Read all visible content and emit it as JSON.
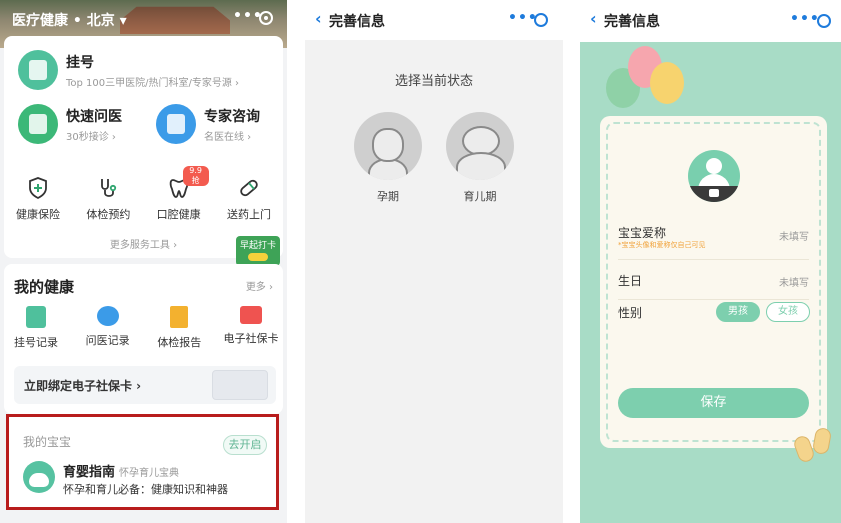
{
  "panel1": {
    "header": {
      "title": "医疗健康 • 北京 ▾",
      "more": "•••"
    },
    "main_services": [
      {
        "title": "挂号",
        "sub": "Top 100三甲医院/热门科室/专家号源 ›",
        "color": "#4fc09c"
      },
      {
        "title": "快速问医",
        "sub": "30秒接诊 ›",
        "color": "#3cb878"
      },
      {
        "title": "专家咨询",
        "sub": "名医在线 ›",
        "color": "#3b9be8"
      }
    ],
    "tools": [
      {
        "label": "健康保险",
        "icon": "shield-plus-icon"
      },
      {
        "label": "体检预约",
        "icon": "stethoscope-icon"
      },
      {
        "label": "口腔健康",
        "icon": "tooth-icon",
        "badge": "9.9抢"
      },
      {
        "label": "送药上门",
        "icon": "pill-icon"
      }
    ],
    "more_tools": "更多服务工具 ›",
    "promo": {
      "label": "早起打卡"
    },
    "my_health": {
      "title": "我的健康",
      "more": "更多 ›",
      "items": [
        {
          "label": "挂号记录",
          "icon": "register-record-icon",
          "color": "#4fc09c"
        },
        {
          "label": "问医记录",
          "icon": "chat-record-icon",
          "color": "#3b9be8"
        },
        {
          "label": "体检报告",
          "icon": "report-icon",
          "color": "#f3b12f"
        },
        {
          "label": "电子社保卡",
          "icon": "social-card-icon",
          "color": "#ef5350"
        }
      ],
      "bind_card": "立即绑定电子社保卡 ›"
    },
    "baby": {
      "title": "我的宝宝",
      "open_button": "去开启",
      "guide_title": "育婴指南",
      "guide_tag": "怀孕育儿宝典",
      "guide_desc": "怀孕和育儿必备：健康知识和神器"
    }
  },
  "panel2": {
    "nav_title": "完善信息",
    "question": "选择当前状态",
    "stages": [
      {
        "label": "孕期"
      },
      {
        "label": "育儿期"
      }
    ]
  },
  "panel3": {
    "nav_title": "完善信息",
    "fields": {
      "nickname_label": "宝宝爱称",
      "nickname_value": "未填写",
      "nickname_hint": "*宝宝头像和爱称仅自己可见",
      "birthday_label": "生日",
      "birthday_value": "未填写",
      "gender_label": "性别",
      "gender_options": [
        "男孩",
        "女孩"
      ]
    },
    "save_button": "保存",
    "colors": {
      "accent": "#7dcfae",
      "background": "#a8dcc6"
    }
  }
}
